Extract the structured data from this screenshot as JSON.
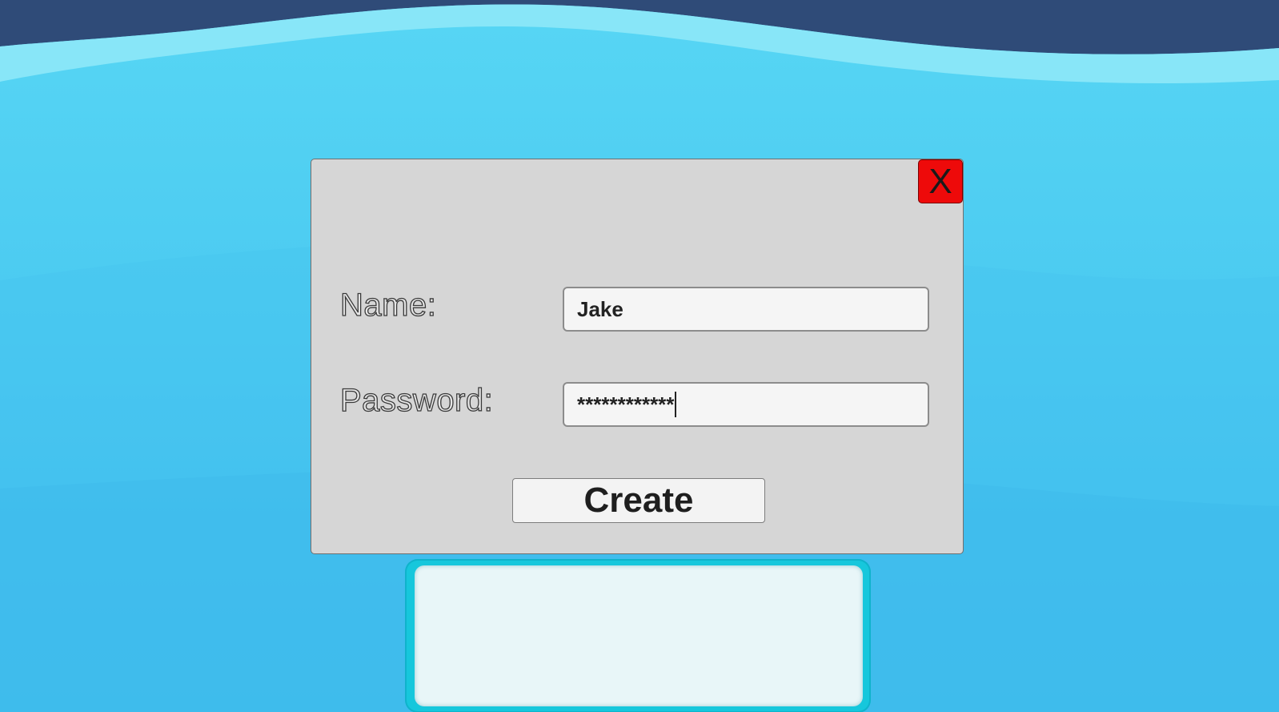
{
  "dialog": {
    "close_label": "X",
    "name_label": "Name:",
    "name_value": "Jake",
    "password_label": "Password:",
    "password_value": "************",
    "create_label": "Create"
  },
  "message_panel": {
    "text": ""
  },
  "colors": {
    "background_top": "#2f4b78",
    "background_water": "#4ccbf1",
    "dialog_bg": "#d6d6d6",
    "close_button": "#ee0a0a",
    "panel_border": "#16c7dc",
    "panel_fill": "#e8f6f8"
  }
}
